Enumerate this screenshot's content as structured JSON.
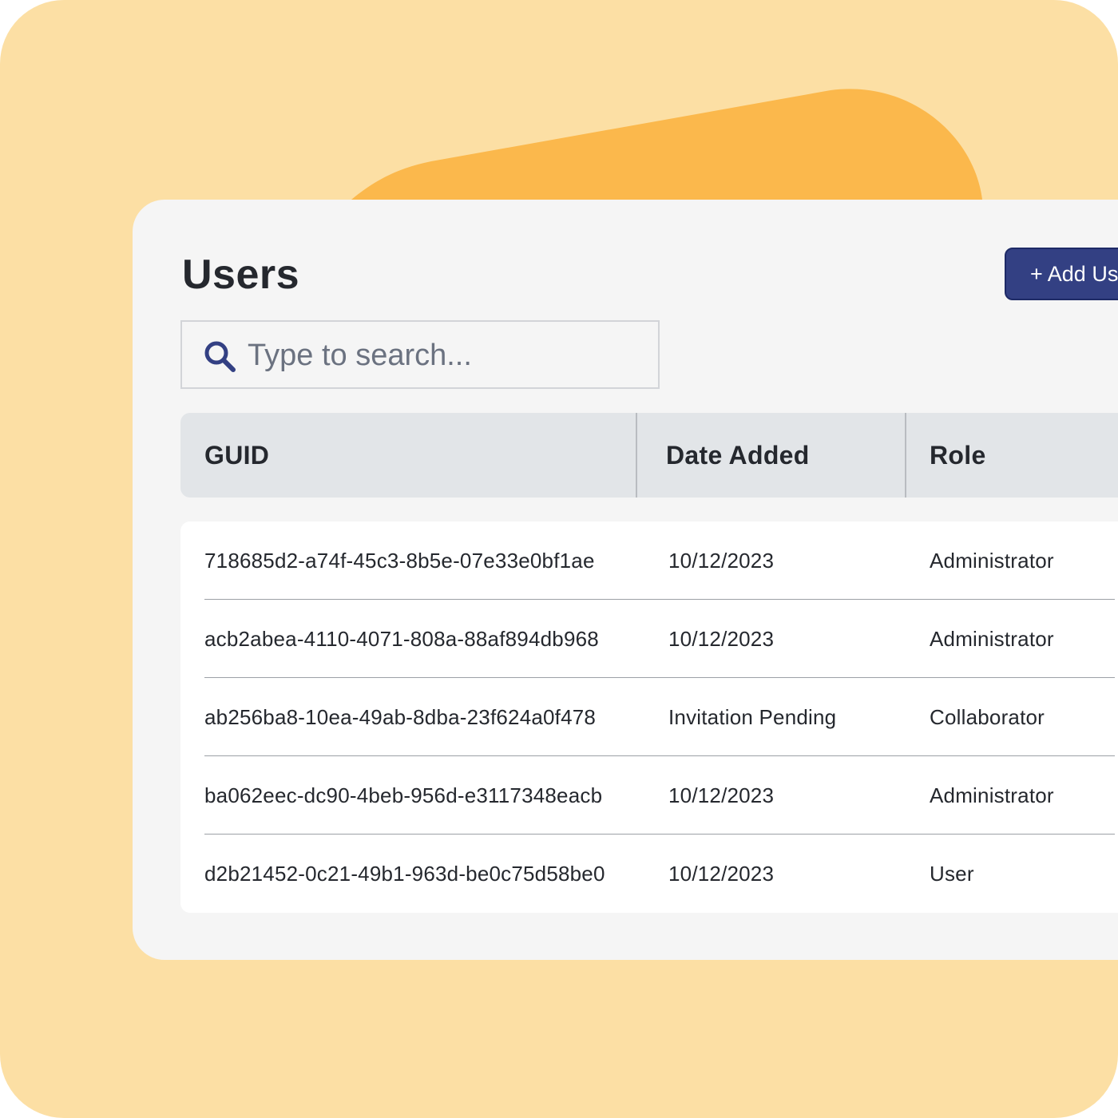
{
  "colors": {
    "background": "#fcdfa4",
    "accent_blob": "#fbb84c",
    "card": "#f5f5f5",
    "primary_button": "#334083",
    "table_header": "#e2e5e8",
    "search_icon": "#334083"
  },
  "page": {
    "title": "Users",
    "add_button_label": "+ Add User"
  },
  "search": {
    "placeholder": "Type to search...",
    "value": "",
    "icon": "search-icon"
  },
  "table": {
    "columns": [
      "GUID",
      "Date Added",
      "Role"
    ],
    "rows": [
      {
        "guid": "718685d2-a74f-45c3-8b5e-07e33e0bf1ae",
        "date": "10/12/2023",
        "role": "Administrator"
      },
      {
        "guid": "acb2abea-4110-4071-808a-88af894db968",
        "date": "10/12/2023",
        "role": "Administrator"
      },
      {
        "guid": "ab256ba8-10ea-49ab-8dba-23f624a0f478",
        "date": "Invitation Pending",
        "role": "Collaborator"
      },
      {
        "guid": "ba062eec-dc90-4beb-956d-e3117348eacb",
        "date": "10/12/2023",
        "role": "Administrator"
      },
      {
        "guid": "d2b21452-0c21-49b1-963d-be0c75d58be0",
        "date": "10/12/2023",
        "role": "User"
      }
    ]
  }
}
